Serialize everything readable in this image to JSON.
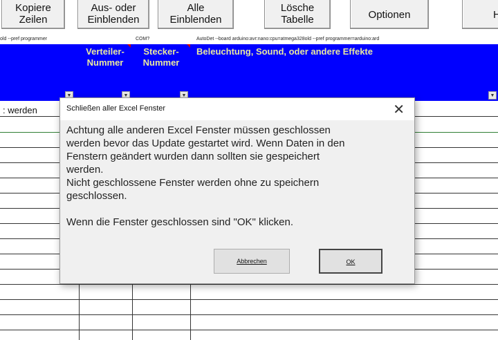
{
  "ribbon": {
    "buttons": [
      {
        "lines": [
          "Kopiere",
          "Zeilen"
        ],
        "name": "kopiere-zeilen-button"
      },
      {
        "lines": [
          "Aus- oder",
          "Einblenden"
        ],
        "name": "aus-einblenden-button"
      },
      {
        "lines": [
          "Alle",
          "Einblenden"
        ],
        "name": "alle-einblenden-button"
      },
      {
        "lines": [
          "Lösche",
          "Tabelle"
        ],
        "name": "loesche-tabelle-button"
      },
      {
        "lines": [
          "Optionen"
        ],
        "name": "optionen-button"
      },
      {
        "lines": [
          "H"
        ],
        "name": "hilfe-button"
      }
    ]
  },
  "params": {
    "p1": "old --pref programmer",
    "p2": "COM?",
    "p3": "AutoDet --board arduino:avr:nano:cpu=atmega328old --pref programmer=arduino:ard"
  },
  "columns": {
    "verteiler": [
      "Verteiler-",
      "Nummer"
    ],
    "stecker": [
      "Stecker-",
      "Nummer"
    ],
    "effekte": "Beleuchtung, Sound, oder andere Effekte"
  },
  "grid": {
    "first_cell": ": werden"
  },
  "dialog": {
    "title": "Schließen aller Excel Fenster",
    "message": [
      "Achtung alle anderen Excel Fenster müssen geschlossen",
      "werden bevor das Update gestartet wird. Wenn Daten in den",
      "Fenstern geändert wurden dann sollten sie gespeichert",
      "werden.",
      "Nicht geschlossene Fenster werden ohne zu speichern",
      "geschlossen.",
      "",
      "Wenn die Fenster geschlossen sind \"OK\" klicken."
    ],
    "cancel_label": "Abbrechen",
    "ok_label": "OK",
    "close_symbol": "✕"
  },
  "colors": {
    "header_bg": "#0000ff",
    "header_text": "#e8e8a0"
  }
}
